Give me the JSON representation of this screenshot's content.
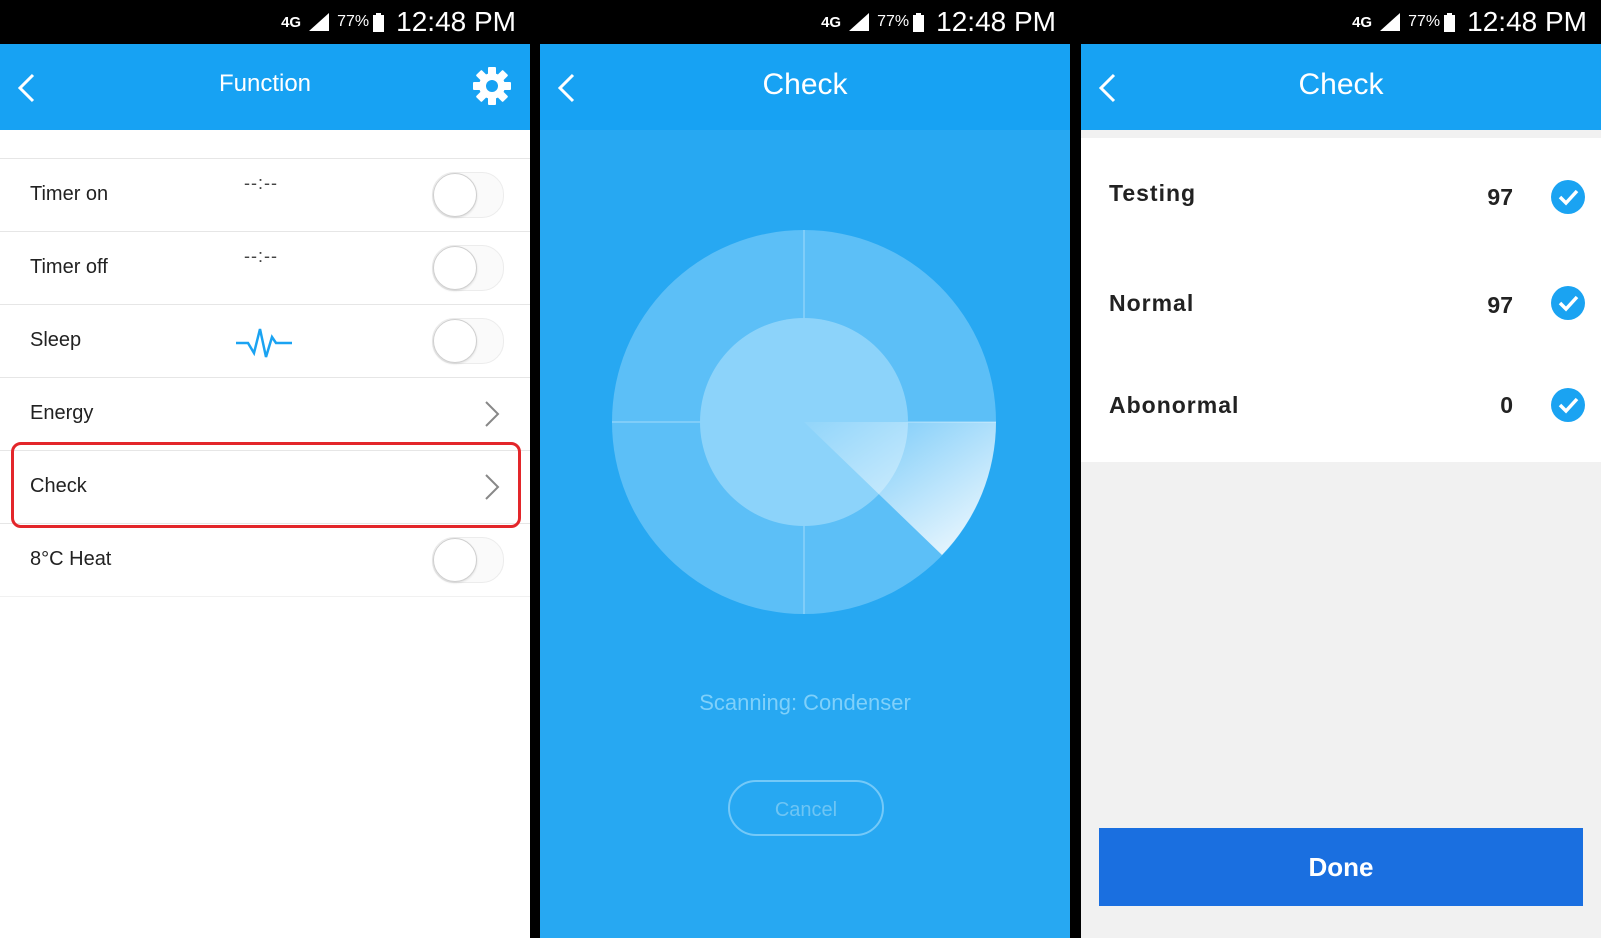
{
  "status_bar": {
    "network": "4G",
    "battery": "77%",
    "time": "12:48 PM"
  },
  "colors": {
    "primary": "#17a2f3",
    "highlight_border": "#e3262a",
    "done_button": "#1a6fe0",
    "check_icon": "#1aa3f2"
  },
  "screen1": {
    "title": "Function",
    "rows": [
      {
        "label": "Timer on",
        "value": "--:--",
        "control": "toggle",
        "on": false
      },
      {
        "label": "Timer off",
        "value": "--:--",
        "control": "toggle",
        "on": false
      },
      {
        "label": "Sleep",
        "icon": "sleep-pulse-icon",
        "control": "toggle",
        "on": false
      },
      {
        "label": "Energy",
        "control": "chevron"
      },
      {
        "label": "Check",
        "control": "chevron",
        "highlighted": true
      },
      {
        "label": "8°C Heat",
        "control": "toggle",
        "on": false
      }
    ]
  },
  "screen2": {
    "title": "Check",
    "scanning_text": "Scanning: Condenser",
    "cancel_label": "Cancel"
  },
  "screen3": {
    "title": "Check",
    "results": [
      {
        "label": "Testing",
        "value": "97"
      },
      {
        "label": "Normal",
        "value": "97"
      },
      {
        "label": "Abonormal",
        "value": "0"
      }
    ],
    "done_label": "Done"
  }
}
